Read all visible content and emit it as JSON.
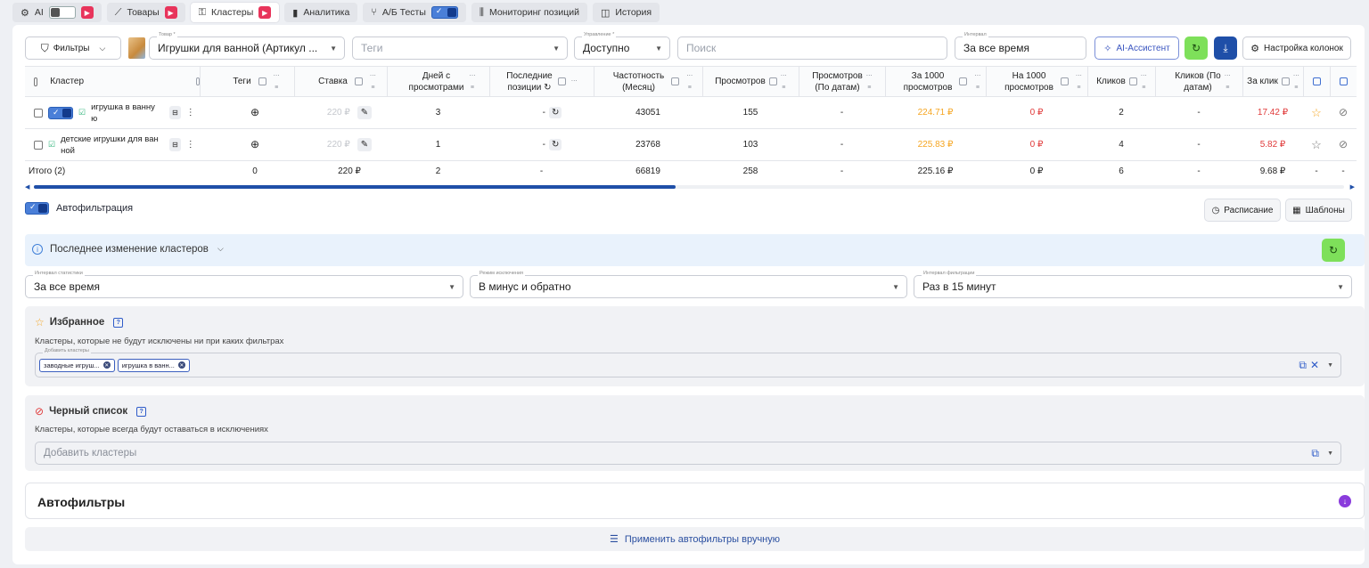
{
  "tabs": [
    {
      "label": "AI",
      "icon": "chip-icon"
    },
    {
      "label": "Товары",
      "icon": "chart-line-icon"
    },
    {
      "label": "Кластеры",
      "icon": "key-icon"
    },
    {
      "label": "Аналитика",
      "icon": "bar-chart-icon"
    },
    {
      "label": "А/Б Тесты",
      "icon": "split-icon"
    },
    {
      "label": "Мониторинг позиций",
      "icon": "sliders-icon"
    },
    {
      "label": "История",
      "icon": "history-icon"
    }
  ],
  "toolbar": {
    "filters_label": "Фильтры",
    "product_label": "Товар *",
    "product_value": "Игрушки для ванной (Артикул ...",
    "tags_placeholder": "Теги",
    "management_label": "Управление *",
    "management_value": "Доступно",
    "search_placeholder": "Поиск",
    "interval_label": "Интервал",
    "interval_value": "За все время",
    "ai_assistant_label": "AI-Ассистент",
    "columns_settings_label": "Настройка колонок",
    "accent_green": "#7ee05a",
    "accent_blue": "#1f4fa8"
  },
  "table": {
    "headers": {
      "cluster": "Кластер",
      "tags": "Теги",
      "bid": "Ставка",
      "days_views_1": "Дней с",
      "days_views_2": "просмотрами",
      "last_pos_1": "Последние",
      "last_pos_2": "позиции",
      "freq_1": "Частотность",
      "freq_2": "(Месяц)",
      "views": "Просмотров",
      "views_dates_1": "Просмотров",
      "views_dates_2": "(По датам)",
      "per1000_1": "За 1000",
      "per1000_2": "просмотров",
      "on1000_1": "На 1000",
      "on1000_2": "просмотров",
      "clicks": "Кликов",
      "clicks_dates_1": "Кликов (По",
      "clicks_dates_2": "датам)",
      "per_click": "За клик"
    },
    "rows": [
      {
        "cluster_1": "игрушка в ванну",
        "cluster_2": "ю",
        "bid": "220 ₽",
        "days": "3",
        "last_pos": "-",
        "freq": "43051",
        "views": "155",
        "views_dates": "-",
        "per1000": "224.71 ₽",
        "on1000": "0 ₽",
        "clicks": "2",
        "clicks_dates": "-",
        "per_click": "17.42 ₽"
      },
      {
        "cluster_1": "детские игрушки для ван",
        "cluster_2": "ной",
        "bid": "220 ₽",
        "days": "1",
        "last_pos": "-",
        "freq": "23768",
        "views": "103",
        "views_dates": "-",
        "per1000": "225.83 ₽",
        "on1000": "0 ₽",
        "clicks": "4",
        "clicks_dates": "-",
        "per_click": "5.82 ₽"
      }
    ],
    "total": {
      "label": "Итого (2)",
      "tags": "0",
      "bid": "220 ₽",
      "days": "2",
      "last_pos": "-",
      "freq": "66819",
      "views": "258",
      "views_dates": "-",
      "per1000": "225.16 ₽",
      "on1000": "0 ₽",
      "clicks": "6",
      "clicks_dates": "-",
      "per_click": "9.68 ₽",
      "c1": "-",
      "c2": "-"
    },
    "scroll_fraction": 0.49
  },
  "autofilter": {
    "label": "Автофильтрация",
    "schedule_label": "Расписание",
    "templates_label": "Шаблоны"
  },
  "last_change": {
    "label": "Последнее изменение кластеров"
  },
  "selects": {
    "stat_interval_label": "Интервал статистики",
    "stat_interval_value": "За все время",
    "exclude_mode_label": "Режим исключения",
    "exclude_mode_value": "В минус и обратно",
    "filter_interval_label": "Интервал фильтрации",
    "filter_interval_value": "Раз в 15 минут"
  },
  "favorites": {
    "title": "Избранное",
    "description": "Кластеры, которые не будут исключены ни при каких фильтрах",
    "field_label": "Добавить кластеры",
    "chips": [
      "заводные игруш...",
      "игрушка в ванн..."
    ]
  },
  "blacklist": {
    "title": "Черный список",
    "description": "Кластеры, которые всегда будут оставаться в исключениях",
    "placeholder": "Добавить кластеры"
  },
  "autofilters": {
    "title": "Автофильтры",
    "apply_label": "Применить автофильтры вручную",
    "accent": "#8a3cdc"
  }
}
